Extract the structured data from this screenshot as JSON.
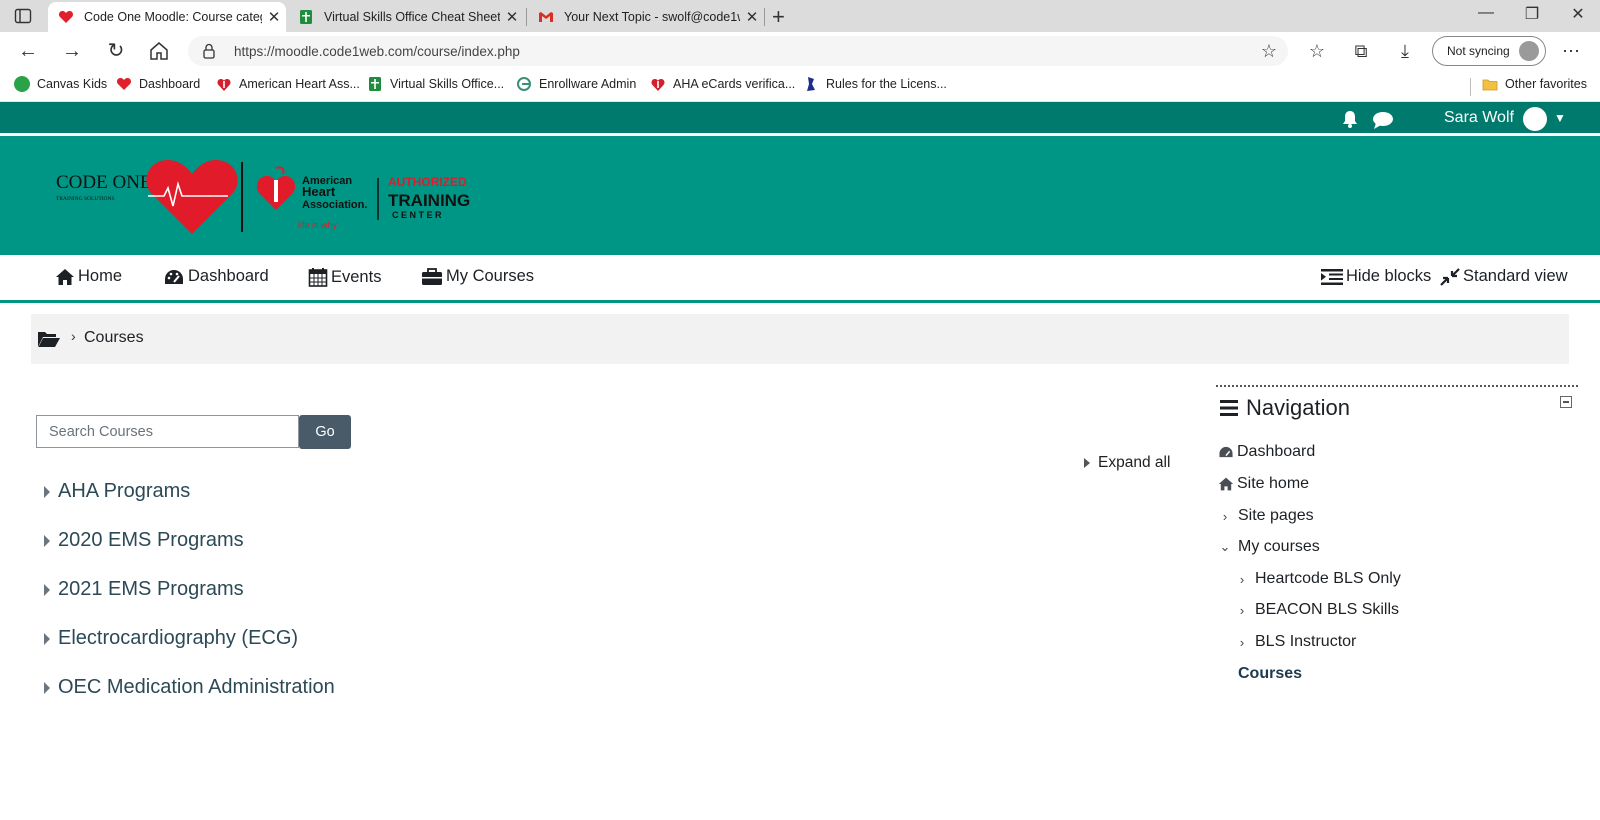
{
  "browser": {
    "tabs": [
      {
        "title": "Code One Moodle: Course categ",
        "icon": "heart-favicon",
        "active": true
      },
      {
        "title": "Virtual Skills Office Cheat Sheet -",
        "icon": "sheets-favicon",
        "active": false
      },
      {
        "title": "Your Next Topic - swolf@code1w",
        "icon": "gmail-favicon",
        "active": false
      }
    ],
    "url": "https://moodle.code1web.com/course/index.php",
    "sync_label": "Not syncing",
    "favorites": [
      {
        "label": "Canvas Kids",
        "icon": "canvas-icon"
      },
      {
        "label": "Dashboard",
        "icon": "heart-icon"
      },
      {
        "label": "American Heart Ass...",
        "icon": "aha-icon"
      },
      {
        "label": "Virtual Skills Office...",
        "icon": "sheets-icon"
      },
      {
        "label": "Enrollware Admin",
        "icon": "enrollware-icon"
      },
      {
        "label": "AHA eCards verifica...",
        "icon": "aha-icon"
      },
      {
        "label": "Rules for the Licens...",
        "icon": "license-icon"
      }
    ],
    "other_favorites": "Other favorites"
  },
  "topbar": {
    "user_name": "Sara Wolf"
  },
  "header": {
    "logo_brand": "CODE ONE",
    "logo_sub": "TRAINING SOLUTIONS",
    "aha_line1": "American",
    "aha_line2": "Heart",
    "aha_line3": "Association.",
    "aha_tagline": "life is why",
    "authorized": "AUTHORIZED",
    "training": "TRAINING",
    "center": "C E N T E R"
  },
  "nav": {
    "home": "Home",
    "dashboard": "Dashboard",
    "events": "Events",
    "my_courses": "My Courses",
    "hide_blocks": "Hide blocks",
    "standard_view": "Standard view"
  },
  "breadcrumb": {
    "current": "Courses"
  },
  "search": {
    "placeholder": "Search Courses",
    "go": "Go"
  },
  "expand_all": "Expand all",
  "categories": [
    "AHA Programs",
    "2020 EMS Programs",
    "2021 EMS Programs",
    "Electrocardiography (ECG)",
    "OEC Medication Administration"
  ],
  "navigation_block": {
    "title": "Navigation",
    "dashboard": "Dashboard",
    "site_home": "Site home",
    "site_pages": "Site pages",
    "my_courses": "My courses",
    "courses_list": [
      "Heartcode BLS Only",
      "BEACON BLS Skills",
      "BLS Instructor"
    ],
    "courses": "Courses"
  },
  "colors": {
    "topbar": "#007a6c",
    "header": "#009685",
    "go_button": "#495b68",
    "category_text": "#2c4a56"
  }
}
